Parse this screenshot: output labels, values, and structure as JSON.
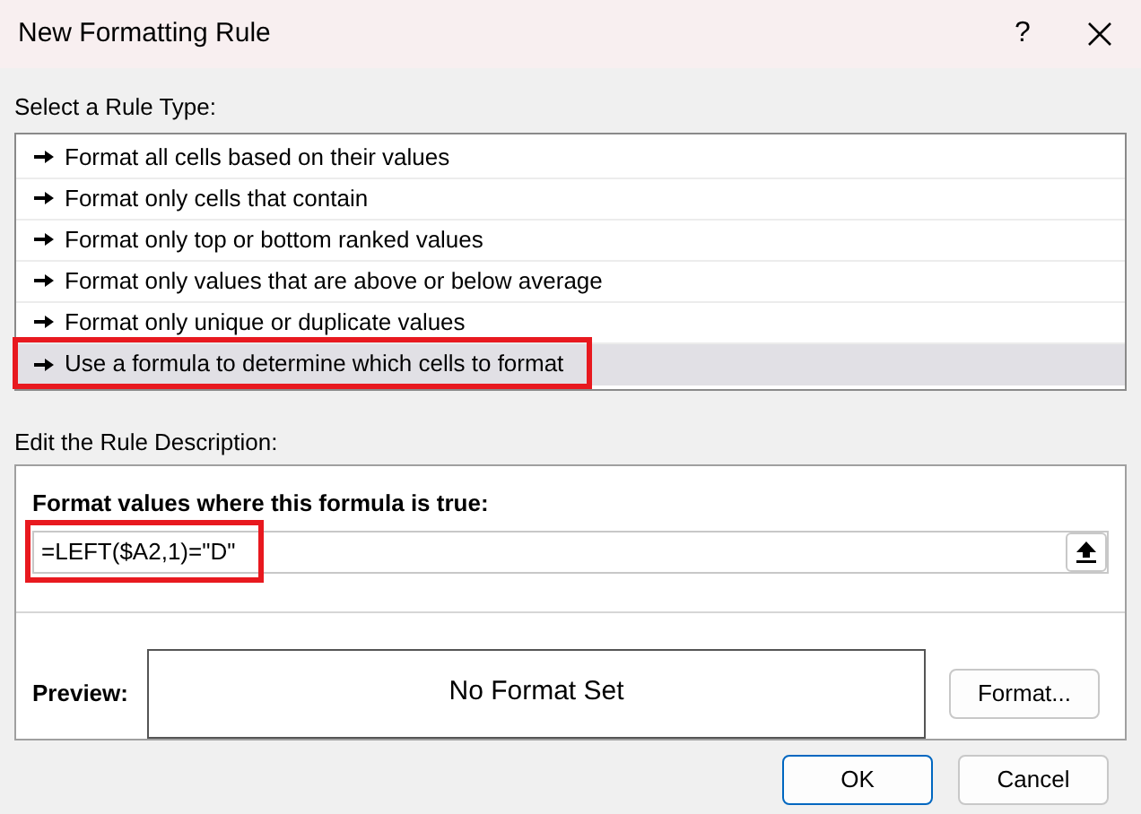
{
  "window": {
    "title": "New Formatting Rule",
    "help": "?"
  },
  "rule_type": {
    "label": "Select a Rule Type:",
    "items": [
      {
        "label": "Format all cells based on their values",
        "selected": false,
        "highlighted": false
      },
      {
        "label": "Format only cells that contain",
        "selected": false,
        "highlighted": false
      },
      {
        "label": "Format only top or bottom ranked values",
        "selected": false,
        "highlighted": false
      },
      {
        "label": "Format only values that are above or below average",
        "selected": false,
        "highlighted": false
      },
      {
        "label": "Format only unique or duplicate values",
        "selected": false,
        "highlighted": false
      },
      {
        "label": "Use a formula to determine which cells to format",
        "selected": true,
        "highlighted": true
      }
    ]
  },
  "description": {
    "label": "Edit the Rule Description:",
    "formula_label": "Format values where this formula is true:",
    "formula": {
      "value": "=LEFT($A2,1)=\"D\"",
      "highlighted": true
    },
    "preview_label": "Preview:",
    "preview_text": "No Format Set",
    "format_button": "Format..."
  },
  "buttons": [
    "OK",
    "Cancel"
  ]
}
